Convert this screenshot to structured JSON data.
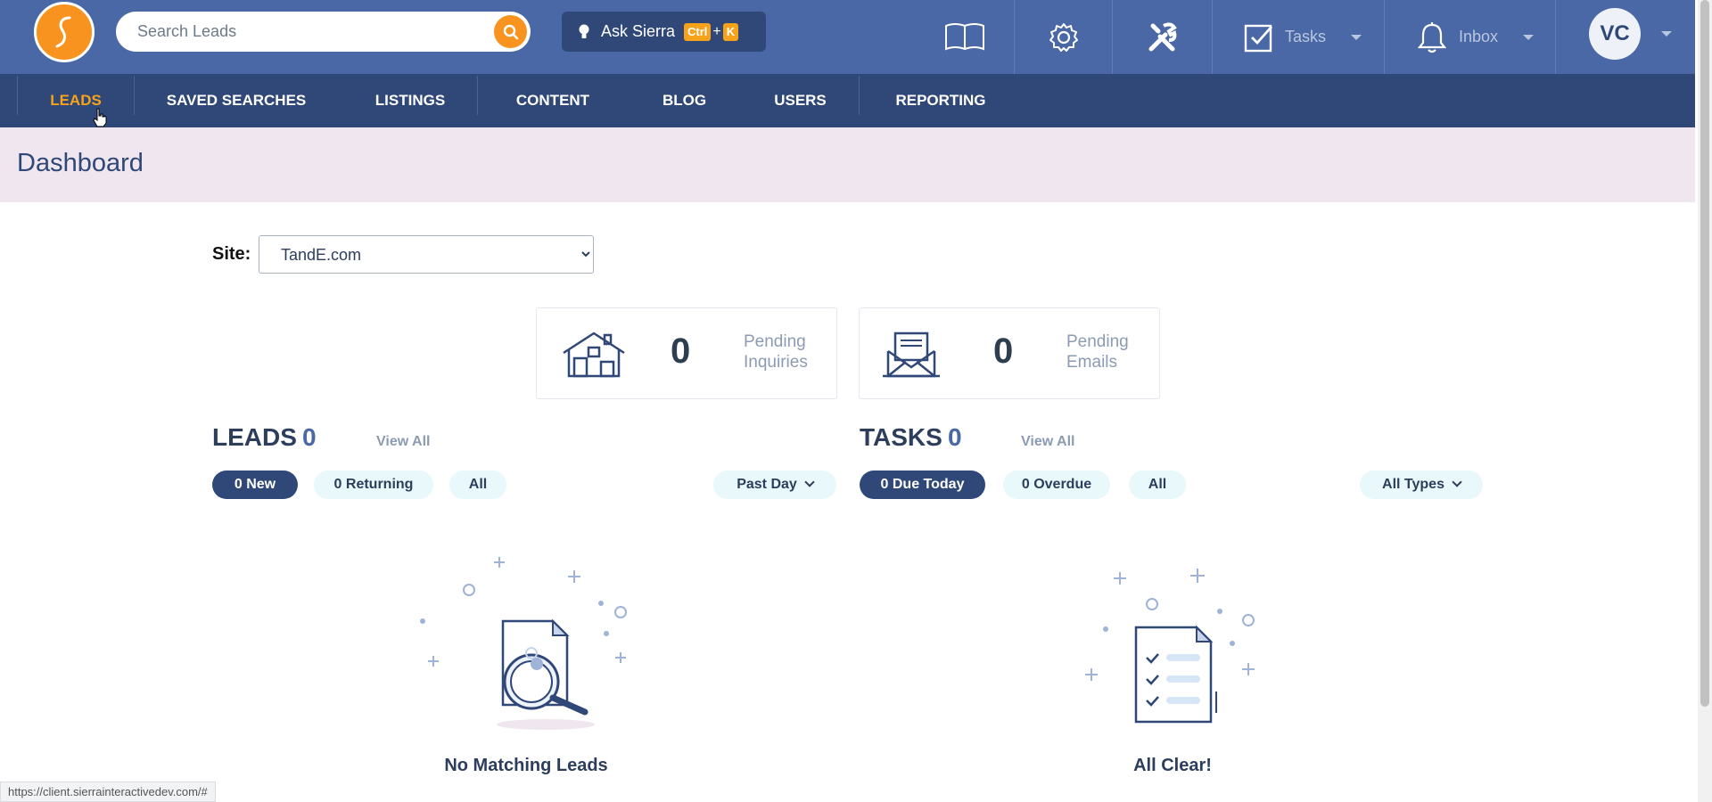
{
  "header": {
    "search_placeholder": "Search Leads",
    "ask": {
      "label": "Ask Sierra",
      "key1": "Ctrl",
      "plus": "+",
      "key2": "K"
    },
    "tasks_label": "Tasks",
    "inbox_label": "Inbox",
    "avatar_initials": "VC",
    "icons": [
      "book-icon",
      "gear-icon",
      "tools-icon",
      "checkbox-icon",
      "bell-icon"
    ]
  },
  "nav": {
    "items": [
      {
        "label": "LEADS",
        "active": true
      },
      {
        "label": "SAVED SEARCHES"
      },
      {
        "label": "LISTINGS"
      },
      {
        "label": "CONTENT"
      },
      {
        "label": "BLOG"
      },
      {
        "label": "USERS"
      },
      {
        "label": "REPORTING"
      }
    ]
  },
  "page": {
    "title": "Dashboard"
  },
  "site": {
    "label": "Site:",
    "selected": "TandE.com"
  },
  "cards": [
    {
      "count": "0",
      "label_line1": "Pending",
      "label_line2": "Inquiries",
      "icon": "house-icon"
    },
    {
      "count": "0",
      "label_line1": "Pending",
      "label_line2": "Emails",
      "icon": "envelope-icon"
    }
  ],
  "leads": {
    "title": "LEADS",
    "count": "0",
    "view_all": "View All",
    "filters": [
      "0 New",
      "0 Returning",
      "All"
    ],
    "range": "Past Day",
    "empty_message": "No Matching Leads"
  },
  "tasks": {
    "title": "TASKS",
    "count": "0",
    "view_all": "View All",
    "filters": [
      "0 Due Today",
      "0 Overdue",
      "All"
    ],
    "types": "All Types",
    "empty_message": "All Clear!"
  },
  "status_url": "https://client.sierrainteractivedev.com/#",
  "colors": {
    "brand_orange": "#f7931e",
    "header_blue": "#4a68a5",
    "nav_navy": "#2f4878",
    "title_bg": "#f0e6f0"
  }
}
